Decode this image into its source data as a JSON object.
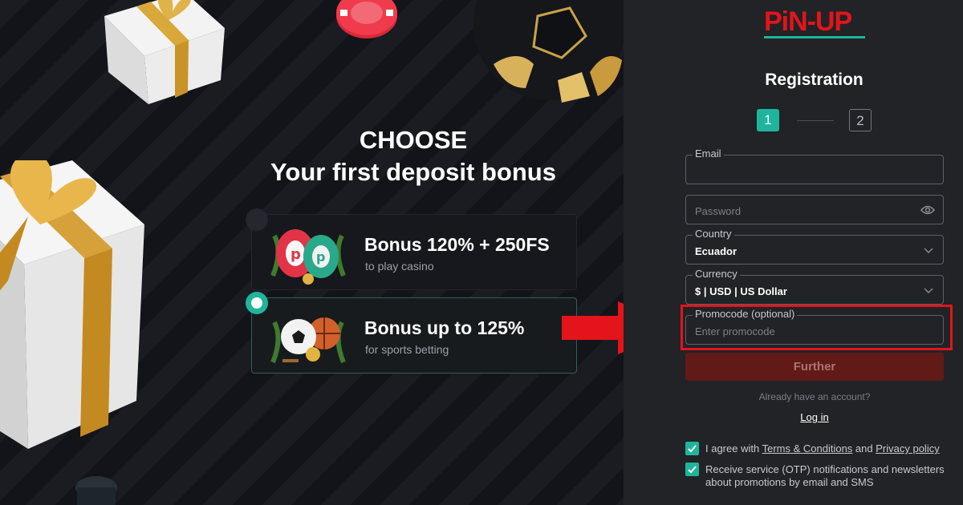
{
  "promo": {
    "headline_line1": "CHOOSE",
    "headline_line2": "Your first deposit bonus",
    "bonuses": [
      {
        "title": "Bonus 120% + 250FS",
        "subtitle": "to play casino",
        "selected": false
      },
      {
        "title": "Bonus up to 125%",
        "subtitle": "for sports betting",
        "selected": true
      }
    ]
  },
  "form": {
    "logo_text": "PiN-UP",
    "title": "Registration",
    "steps": [
      "1",
      "2"
    ],
    "active_step": 1,
    "email": {
      "label": "Email",
      "value": ""
    },
    "password": {
      "placeholder": "Password"
    },
    "country": {
      "label": "Country",
      "value": "Ecuador"
    },
    "currency": {
      "label": "Currency",
      "value": "$ | USD | US Dollar"
    },
    "promocode": {
      "label": "Promocode (optional)",
      "placeholder": "Enter promocode"
    },
    "further_label": "Further",
    "already_text": "Already have an account?",
    "login_label": "Log in",
    "agree": {
      "prefix": "I agree with ",
      "terms": "Terms & Conditions",
      "and": " and ",
      "privacy": "Privacy policy",
      "checked": true
    },
    "otp": {
      "text": "Receive service (OTP) notifications and newsletters about promotions by email and SMS",
      "checked": true
    }
  },
  "colors": {
    "accent": "#1fb59c",
    "brand_red": "#e4141b",
    "button_disabled": "#611a17"
  }
}
